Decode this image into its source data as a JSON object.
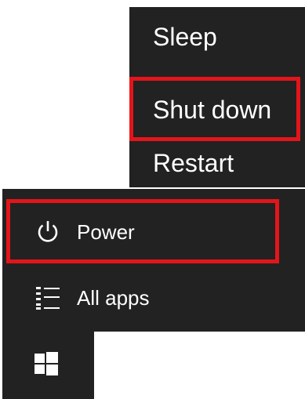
{
  "power_menu": {
    "items": [
      {
        "label": "Sleep"
      },
      {
        "label": "Shut down"
      },
      {
        "label": "Restart"
      }
    ]
  },
  "start_menu": {
    "power_label": "Power",
    "all_apps_label": "All apps",
    "icons": {
      "power": "power-icon",
      "all_apps": "list-icon",
      "start": "windows-logo-icon"
    }
  },
  "colors": {
    "menu_background": "#222222",
    "highlight": "#e3151a",
    "text": "#ffffff"
  }
}
